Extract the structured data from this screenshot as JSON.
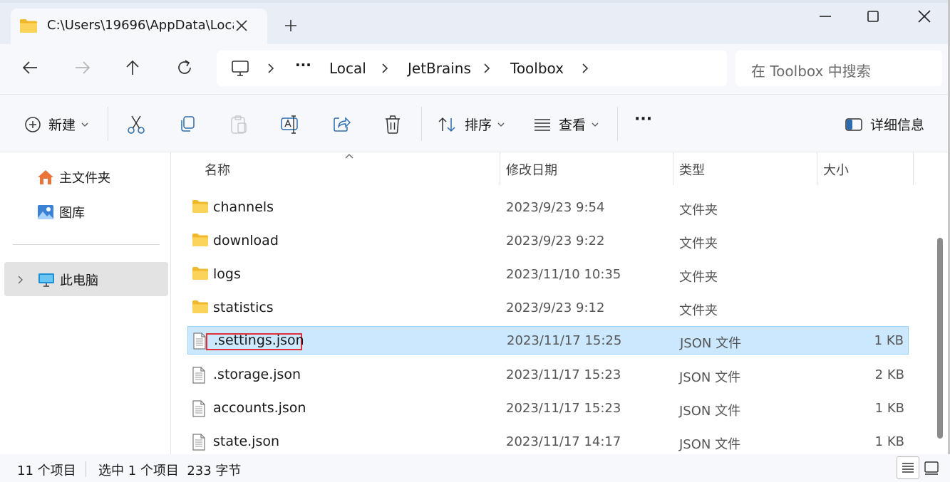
{
  "tab": {
    "title": "C:\\Users\\19696\\AppData\\Loca"
  },
  "address": {
    "more": "···",
    "crumbs": [
      "Local",
      "JetBrains",
      "Toolbox"
    ]
  },
  "search": {
    "placeholder": "在 Toolbox 中搜索"
  },
  "toolbar": {
    "new_label": "新建",
    "sort_label": "排序",
    "view_label": "查看",
    "details_label": "详细信息",
    "more_label": "···"
  },
  "sidebar": {
    "items": [
      {
        "label": "主文件夹",
        "icon": "home-icon"
      },
      {
        "label": "图库",
        "icon": "gallery-icon"
      },
      {
        "label": "此电脑",
        "icon": "this-pc-icon"
      }
    ]
  },
  "columns": {
    "name": "名称",
    "date": "修改日期",
    "type": "类型",
    "size": "大小"
  },
  "files": [
    {
      "name": "channels",
      "date": "2023/9/23 9:54",
      "type": "文件夹",
      "size": "",
      "kind": "folder"
    },
    {
      "name": "download",
      "date": "2023/9/23 9:22",
      "type": "文件夹",
      "size": "",
      "kind": "folder"
    },
    {
      "name": "logs",
      "date": "2023/11/10 10:35",
      "type": "文件夹",
      "size": "",
      "kind": "folder"
    },
    {
      "name": "statistics",
      "date": "2023/9/23 9:12",
      "type": "文件夹",
      "size": "",
      "kind": "folder"
    },
    {
      "name": ".settings.json",
      "date": "2023/11/17 15:25",
      "type": "JSON 文件",
      "size": "1 KB",
      "kind": "file"
    },
    {
      "name": ".storage.json",
      "date": "2023/11/17 15:23",
      "type": "JSON 文件",
      "size": "2 KB",
      "kind": "file"
    },
    {
      "name": "accounts.json",
      "date": "2023/11/17 15:23",
      "type": "JSON 文件",
      "size": "1 KB",
      "kind": "file"
    },
    {
      "name": "state.json",
      "date": "2023/11/17 14:17",
      "type": "JSON 文件",
      "size": "1 KB",
      "kind": "file"
    }
  ],
  "status": {
    "item_count": "11 个项目",
    "selection": "选中 1 个项目  233 字节"
  },
  "colors": {
    "selection_bg": "#cce8ff",
    "selection_border": "#99d1ff",
    "highlight_box": "#e0303a",
    "folder": "#f8c33c"
  }
}
